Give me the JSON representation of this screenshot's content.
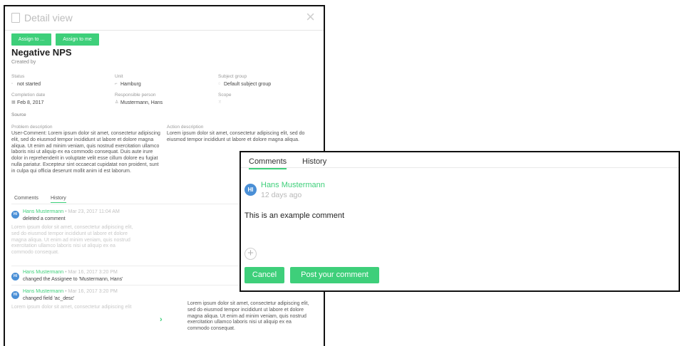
{
  "detail": {
    "title": "Detail view",
    "assign_to_label": "Assign to ...",
    "assign_to_me_label": "Assign to me",
    "heading": "Negative NPS",
    "created_by": "Created by",
    "fields": {
      "status_label": "Status",
      "status_value": "not started",
      "unit_label": "Unit",
      "unit_value": "Hamburg",
      "subject_group_label": "Subject group",
      "subject_group_value": "Default subject group",
      "completion_label": "Completion date",
      "completion_value": "Feb 8, 2017",
      "responsible_label": "Responsible person",
      "responsible_value": "Mustermann, Hans",
      "scope_label": "Scope",
      "source_label": "Source"
    },
    "problem_label": "Problem description",
    "problem_text": "User-Comment: Lorem ipsum dolor sit amet, consectetur adipiscing elit, sed do eiusmod tempor incididunt ut labore et dolore magna aliqua. Ut enim ad minim veniam, quis nostrud exercitation ullamco laboris nisi ut aliquip ex ea commodo consequat. Duis aute irure dolor in reprehenderit in voluptate velit esse cillum dolore eu fugiat nulla pariatur. Excepteur sint occaecat cupidatat non proident, sunt in culpa qui officia deserunt mollit anim id est laborum.",
    "action_label": "Action description",
    "action_text": "Lorem ipsum dolor sit amet, consectetur adipiscing elit, sed do eiusmod tempor incididunt ut labore et dolore magna aliqua.",
    "tabs": [
      "Comments",
      "History"
    ],
    "history": [
      {
        "initials": "HI",
        "name": "Hans Mustermann",
        "time": "• Mar 23, 2017 11:04 AM",
        "action": "deleted a comment",
        "body": "Lorem ipsum dolor sit amet, consectetur adipiscing elit, sed do eiusmod tempor incididunt ut labore et dolore magna aliqua. Ut enim ad minim veniam, quis nostrud exercitation ullamco laboris nisi ut aliquip ex ea commodo consequat."
      },
      {
        "initials": "HI",
        "name": "Hans Mustermann",
        "time": "• Mar 16, 2017 3:20 PM",
        "action": "changed the Assignee to 'Mustermann, Hans'"
      },
      {
        "initials": "HI",
        "name": "Hans Mustermann",
        "time": "• Mar 16, 2017 3:20 PM",
        "action": "changed field 'ac_desc'",
        "old_text": "Lorem ipsum dolor sit amet, consectetur adipiscing elit",
        "new_text": "Lorem ipsum dolor sit amet, consectetur adipiscing elit, sed do eiusmod tempor incididunt ut labore et dolore magna aliqua. Ut enim ad minim veniam, quis nostrud exercitation ullamco laboris nisi ut aliquip ex ea commodo consequat."
      }
    ]
  },
  "comments": {
    "tabs": [
      "Comments",
      "History"
    ],
    "author_initials": "HI",
    "author": "Hans Mustermann",
    "time": "12 days ago",
    "text": "This is an example comment",
    "cancel_label": "Cancel",
    "post_label": "Post your comment"
  },
  "colors": {
    "accent": "#3ecf7a",
    "avatar": "#4a8fd6"
  }
}
